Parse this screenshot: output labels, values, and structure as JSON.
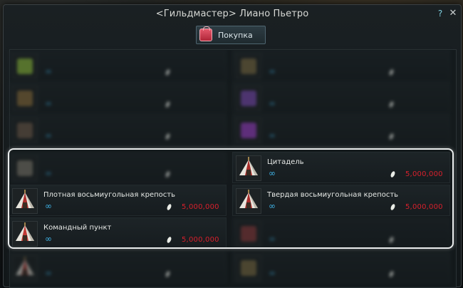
{
  "window": {
    "title": "<Гильдмастер> Лиано Пьетро",
    "help_glyph": "?",
    "close_glyph": "✕"
  },
  "tabs": [
    {
      "label": "Покупка",
      "icon": "bag-icon",
      "color": "#d23a4e"
    }
  ],
  "currency_icon": "silver-coin-icon",
  "infinity_glyph": "∞",
  "rows": [
    [
      {
        "name": "",
        "price": "",
        "price_color": "#8d9395",
        "icon": "green-item-icon",
        "visible": "blurred"
      },
      {
        "name": "",
        "price": "",
        "price_color": "#8d9395",
        "icon": "siege-item-icon",
        "visible": "blurred"
      }
    ],
    [
      {
        "name": "",
        "price": "",
        "price_color": "#8d9395",
        "icon": "catapult-icon",
        "visible": "blurred"
      },
      {
        "name": "",
        "price": "",
        "price_color": "#8d9395",
        "icon": "purple-tool-icon",
        "visible": "blurred"
      }
    ],
    [
      {
        "name": "",
        "price": "",
        "price_color": "#8d9395",
        "icon": "barrel-icon",
        "visible": "blurred"
      },
      {
        "name": "",
        "price": "",
        "price_color": "#8d9395",
        "icon": "purple-potion-icon",
        "visible": "blurred"
      }
    ],
    [
      {
        "name": "",
        "price": "",
        "price_color": "#d8202c",
        "icon": "scroll-icon",
        "visible": "blurred"
      },
      {
        "name": "Цитадель",
        "price": "5,000,000",
        "price_color": "#d8202c",
        "icon": "tent-icon",
        "visible": "clear"
      }
    ],
    [
      {
        "name": "Плотная восьмиугольная крепость",
        "price": "5,000,000",
        "price_color": "#d8202c",
        "icon": "tent-icon",
        "visible": "clear"
      },
      {
        "name": "Твердая восьмиугольная крепость",
        "price": "5,000,000",
        "price_color": "#d8202c",
        "icon": "tent-icon",
        "visible": "clear"
      }
    ],
    [
      {
        "name": "Командный пункт",
        "price": "5,000,000",
        "price_color": "#d8202c",
        "icon": "command-tent-icon",
        "visible": "clear"
      },
      {
        "name": "",
        "price": "",
        "price_color": "#d8202c",
        "icon": "shield-item-icon",
        "visible": "blurred"
      }
    ],
    [
      {
        "name": "",
        "price": "",
        "price_color": "#d8202c",
        "icon": "tent-icon",
        "visible": "blurred"
      },
      {
        "name": "",
        "price": "",
        "price_color": "#d8202c",
        "icon": "siege-item-icon",
        "visible": "blurred"
      }
    ]
  ]
}
